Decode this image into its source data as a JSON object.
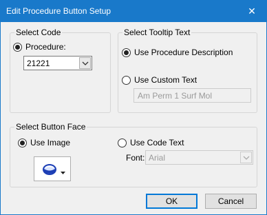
{
  "window": {
    "title": "Edit Procedure Button Setup",
    "close_glyph": "✕"
  },
  "select_code": {
    "legend": "Select Code",
    "procedure_label": "Procedure:",
    "procedure_selected": true,
    "procedure_value": "21221"
  },
  "select_tooltip": {
    "legend": "Select Tooltip Text",
    "use_description_label": "Use Procedure Description",
    "use_description_selected": true,
    "use_custom_label": "Use Custom Text",
    "use_custom_selected": false,
    "custom_text_value": "Am Perm 1 Surf Mol"
  },
  "select_face": {
    "legend": "Select Button Face",
    "use_image_label": "Use Image",
    "use_image_selected": true,
    "use_code_text_label": "Use Code Text",
    "use_code_text_selected": false,
    "font_label": "Font:",
    "font_value": "Arial",
    "image_icon": "tooth-crown-icon"
  },
  "footer": {
    "ok_label": "OK",
    "cancel_label": "Cancel"
  },
  "colors": {
    "titlebar": "#1979ca",
    "dialog_bg": "#f0f0f0",
    "default_button_border": "#0078d7",
    "icon_blue": "#1d3fb5"
  }
}
